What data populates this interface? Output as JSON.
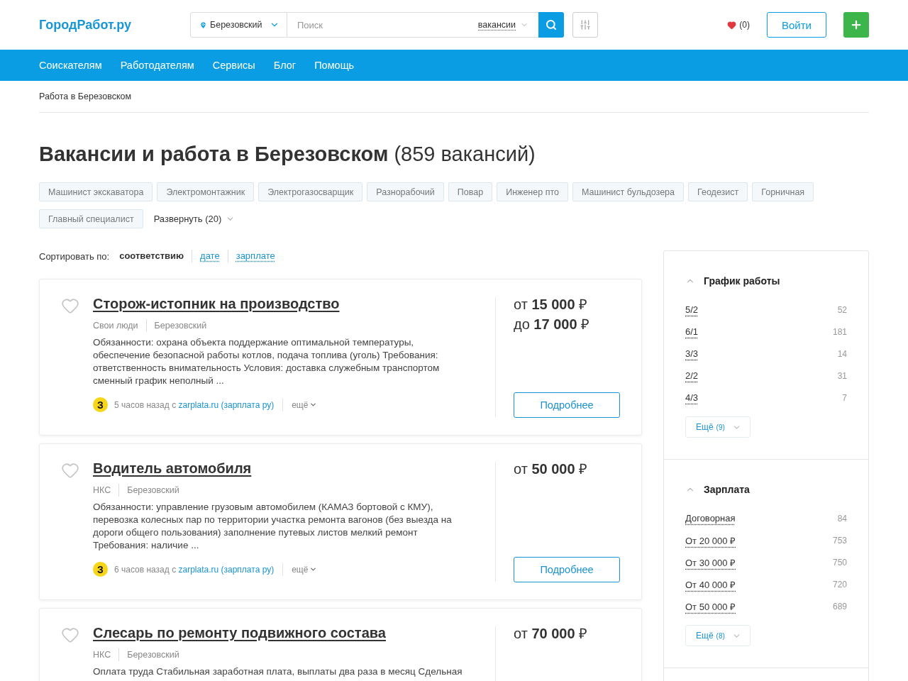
{
  "header": {
    "logo": "ГородРабот.ру",
    "location": "Березовский",
    "search": {
      "placeholder": "Поиск"
    },
    "search_type": "вакансии",
    "favorites_count": "(0)",
    "login_button": "Войти"
  },
  "nav": [
    "Соискателям",
    "Работодателям",
    "Сервисы",
    "Блог",
    "Помощь"
  ],
  "breadcrumb": "Работа в Березовском",
  "heading": "**Вакансии и работа в Березовском** (859 вакансий)",
  "tags": [
    "Машинист экскаватора",
    "Электромонтажник",
    "Электрогазосварщик",
    "Разнорабочий",
    "Повар",
    "Инженер пто",
    "Машинист бульдозера",
    "Геодезист",
    "Горничная",
    "Главный специалист"
  ],
  "expand_tags": "Развернуть (20)",
  "sort": {
    "label": "Сортировать по:",
    "options": [
      {
        "label": "соответствию",
        "selected": true
      },
      {
        "label": "дате",
        "selected": false
      },
      {
        "label": "зарплате",
        "selected": false
      }
    ]
  },
  "vacancies": [
    {
      "title": "Сторож-истопник на производство",
      "favorite": false,
      "company": "Свои люди",
      "city": "Березовский",
      "description": "Обязанности: охрана объекта поддержание оптимальной температуры, обеспечение безопасной работы котлов, подача топлива (уголь) Требования: ответственность внимательность Условия: доставка служебным транспортом сменный график неполный ...",
      "source_badge": "З",
      "posted": "5 часов назад с",
      "source": "zarplata.ru (зарплата ру)",
      "more": "ещё",
      "salary": [
        "от **15 000** ₽",
        "до **17 000** ₽"
      ],
      "details_button": "Подробнее"
    },
    {
      "title": "Водитель автомобиля",
      "favorite": false,
      "company": "НКС",
      "city": "Березовский",
      "description": "Обязанности: управление грузовым автомобилем (КАМАЗ бортовой с КМУ), перевозка колесных пар по территории участка ремонта вагонов (без выезда на дороги общего пользования) заполнение путевых листов мелкий ремонт Требования: наличие ...",
      "source_badge": "З",
      "posted": "6 часов назад с",
      "source": "zarplata.ru (зарплата ру)",
      "more": "ещё",
      "salary": [
        "от **50 000** ₽"
      ],
      "details_button": "Подробнее"
    },
    {
      "title": "Слесарь по ремонту подвижного состава",
      "favorite": false,
      "company": "НКС",
      "city": "Березовский",
      "description": "Оплата труда Стабильная заработная плата, выплаты два раза в месяц Сдельная",
      "salary": [
        "от **70 000** ₽"
      ]
    }
  ],
  "filters": [
    {
      "title": "График работы",
      "expanded": true,
      "items": [
        {
          "label": "5/2",
          "count": "52"
        },
        {
          "label": "6/1",
          "count": "181"
        },
        {
          "label": "3/3",
          "count": "14"
        },
        {
          "label": "2/2",
          "count": "31"
        },
        {
          "label": "4/3",
          "count": "7"
        }
      ],
      "more": "Ещё",
      "more_count": "(9)"
    },
    {
      "title": "Зарплата",
      "expanded": true,
      "items": [
        {
          "label": "Договорная",
          "count": "84"
        },
        {
          "label": "От 20 000 ₽",
          "count": "753"
        },
        {
          "label": "От 30 000 ₽",
          "count": "750"
        },
        {
          "label": "От 40 000 ₽",
          "count": "720"
        },
        {
          "label": "От 50 000 ₽",
          "count": "689"
        }
      ],
      "more": "Ещё",
      "more_count": "(8)"
    }
  ]
}
